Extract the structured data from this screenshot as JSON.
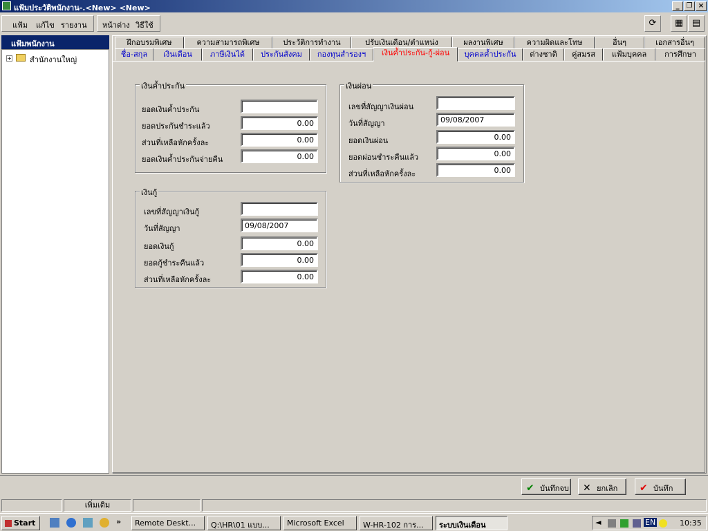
{
  "window": {
    "title": "แฟ้มประวัติพนักงาน-.<New> <New>"
  },
  "menu": {
    "items": [
      "แฟ้ม",
      "แก้ไข",
      "รายงาน",
      "หน้าต่าง",
      "วิธีใช้"
    ]
  },
  "sidebar": {
    "header": "แฟ้มพนักงาน",
    "tree_root": "สำนักงานใหญ่"
  },
  "tabs_row1": [
    "ฝึกอบรมพิเศษ",
    "ความสามารถพิเศษ",
    "ประวัติการทำงาน",
    "ปรับเงินเดือน/ตำแหน่ง",
    "ผลงานพิเศษ",
    "ความผิดและโทษ",
    "อื่นๆ",
    "เอกสารอื่นๆ"
  ],
  "tabs_row2": [
    "ชื่อ-สกุล",
    "เงินเดือน",
    "ภาษีเงินได้",
    "ประกันสังคม",
    "กองทุนสำรองฯ",
    "เงินค้ำประกัน-กู้-ผ่อน",
    "บุคคลค้ำประกัน",
    "ต่างชาติ",
    "คู่สมรส",
    "แฟ้มบุคคล",
    "การศึกษา"
  ],
  "guarantee": {
    "title": "เงินค้ำประกัน",
    "fields": [
      {
        "label": "ยอดเงินค้ำประกัน",
        "value": ""
      },
      {
        "label": "ยอดประกันชำระแล้ว",
        "value": "0.00"
      },
      {
        "label": "ส่วนที่เหลือหักครั้งละ",
        "value": "0.00"
      },
      {
        "label": "ยอดเงินค้ำประกันจ่ายคืน",
        "value": "0.00"
      }
    ]
  },
  "installment": {
    "title": "เงินผ่อน",
    "fields": [
      {
        "label": "เลขที่สัญญาเงินผ่อน",
        "value": ""
      },
      {
        "label": "วันที่สัญญา",
        "value": "09/08/2007"
      },
      {
        "label": "ยอดเงินผ่อน",
        "value": "0.00"
      },
      {
        "label": "ยอดผ่อนชำระคืนแล้ว",
        "value": "0.00"
      },
      {
        "label": "ส่วนที่เหลือหักครั้งละ",
        "value": "0.00"
      }
    ]
  },
  "loan": {
    "title": "เงินกู้",
    "fields": [
      {
        "label": "เลขที่สัญญาเงินกู้",
        "value": ""
      },
      {
        "label": "วันที่สัญญา",
        "value": "09/08/2007"
      },
      {
        "label": "ยอดเงินกู้",
        "value": "0.00"
      },
      {
        "label": "ยอดกู้ชำระคืนแล้ว",
        "value": "0.00"
      },
      {
        "label": "ส่วนที่เหลือหักครั้งละ",
        "value": "0.00"
      }
    ]
  },
  "actions": {
    "save_close": "บันทึกจบ",
    "cancel": "ยกเลิก",
    "save": "บันทึก"
  },
  "status": {
    "mode": "เพิ่มเติม"
  },
  "taskbar": {
    "start": "Start",
    "items": [
      "Remote Deskt...",
      "Q:\\HR\\01 แบบ...",
      "Microsoft Excel",
      "W-HR-102 การ...",
      "ระบบเงินเดือน"
    ],
    "lang": "EN",
    "clock": "10:35"
  },
  "colors": {
    "titlebar": "#0a246a",
    "active_tab": "#ff0000",
    "link_tab": "#0000cc"
  }
}
